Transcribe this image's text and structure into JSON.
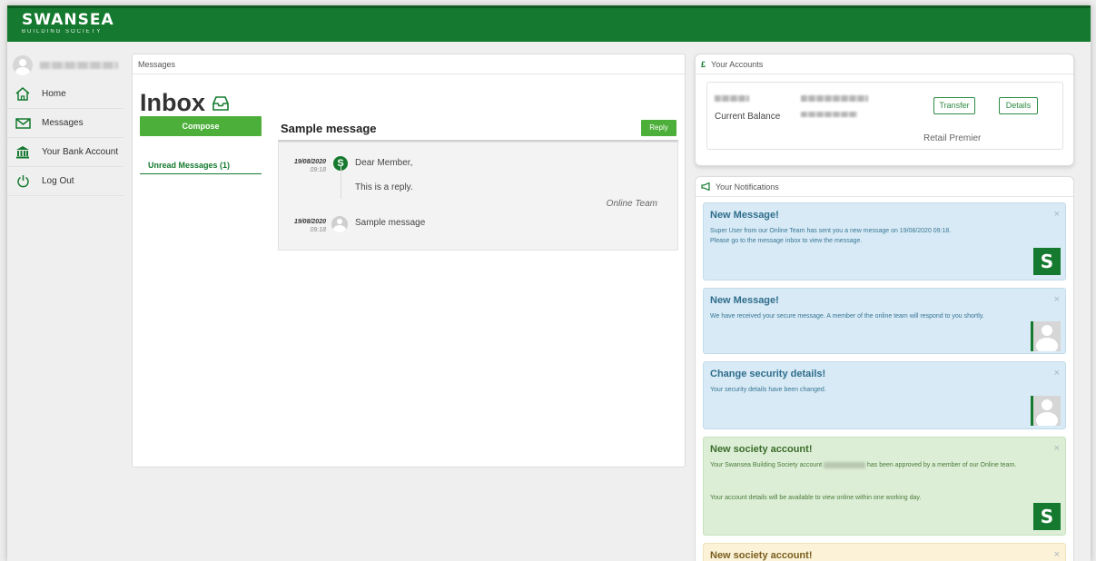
{
  "brand": {
    "name": "SWANSEA",
    "sub": "BUILDING SOCIETY"
  },
  "sidebar": {
    "items": [
      {
        "label": "Home",
        "icon": "home-icon"
      },
      {
        "label": "Messages",
        "icon": "envelope-icon"
      },
      {
        "label": "Your Bank Account",
        "icon": "bank-icon"
      },
      {
        "label": "Log Out",
        "icon": "power-icon"
      }
    ]
  },
  "messages": {
    "panel_title": "Messages",
    "inbox_title": "Inbox",
    "compose_label": "Compose",
    "unread_label": "Unread Messages (1)",
    "thread": {
      "title": "Sample message",
      "reply_label": "Reply",
      "items": [
        {
          "date": "19/08/2020",
          "time": "09:18",
          "text": "Dear Member,",
          "body": "This is a reply.",
          "signature": "Online Team"
        },
        {
          "date": "19/08/2020",
          "time": "09:18",
          "text": "Sample message"
        }
      ]
    }
  },
  "accounts": {
    "panel_title": "Your Accounts",
    "balance_label": "Current Balance",
    "transfer_label": "Transfer",
    "details_label": "Details",
    "account_type": "Retail Premier"
  },
  "notifications": {
    "panel_title": "Your Notifications",
    "items": [
      {
        "title": "New Message!",
        "line1": "Super User from our Online Team has sent you a new message on 19/08/2020 09:18.",
        "line2": "Please go to the message inbox to view the message.",
        "style": "blue"
      },
      {
        "title": "New Message!",
        "line1": "We have received your secure message. A member of the online team will respond to you shortly.",
        "style": "blue"
      },
      {
        "title": "Change security details!",
        "line1": "Your security details have been changed.",
        "style": "blue"
      },
      {
        "title": "New society account!",
        "line1_a": "Your Swansea Building Society account",
        "line1_b": "has been approved by a member of our Online",
        "line1_c": "team.",
        "line2": "Your account details will be available to view online within one working day.",
        "style": "green"
      },
      {
        "title": "New society account!",
        "style": "yellow"
      }
    ],
    "close_glyph": "×",
    "brand_tile": "S"
  },
  "colors": {
    "brand_green": "#157a2f",
    "button_green": "#4caf39",
    "notice_blue": "#d7eaf5",
    "notice_green": "#dceed5",
    "notice_yellow": "#fbf2d7"
  }
}
